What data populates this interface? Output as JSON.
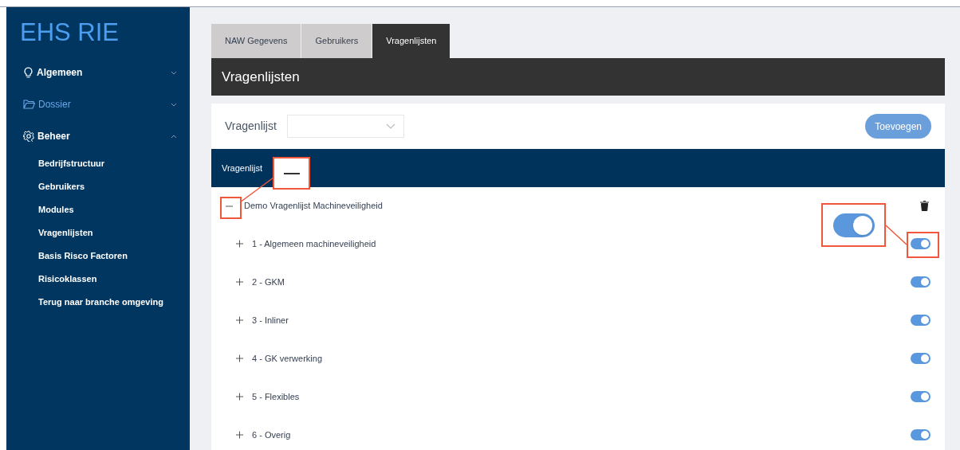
{
  "sidebar": {
    "logo": "EHS RIE",
    "items": [
      {
        "label": "Algemeen",
        "selected": false,
        "expanded": false
      },
      {
        "label": "Dossier",
        "selected": true,
        "expanded": false
      },
      {
        "label": "Beheer",
        "selected": false,
        "expanded": true,
        "children": [
          "Bedrijfstructuur",
          "Gebruikers",
          "Modules",
          "Vragenlijsten",
          "Basis Risco Factoren",
          "Risicoklassen",
          "Terug naar branche omgeving"
        ]
      }
    ]
  },
  "tabs": [
    {
      "label": "NAW Gegevens",
      "selected": false
    },
    {
      "label": "Gebruikers",
      "selected": false
    },
    {
      "label": "Vragenlijsten",
      "selected": true
    }
  ],
  "panel_title": "Vragenlijsten",
  "filter": {
    "label": "Vragenlijst"
  },
  "add_button": "Toevoegen",
  "table": {
    "column": "Vragenlijst",
    "rows": [
      {
        "label": "Demo Vragenlijst Machineveiligheid",
        "expanded": true,
        "children": [
          {
            "label": "1 - Algemeen machineveiligheid",
            "expanded": false,
            "on": true
          },
          {
            "label": "2 - GKM",
            "expanded": false,
            "on": true
          },
          {
            "label": "3 - Inliner",
            "expanded": false,
            "on": true
          },
          {
            "label": "4 - GK verwerking",
            "expanded": false,
            "on": true
          },
          {
            "label": "5 - Flexibles",
            "expanded": false,
            "on": true
          },
          {
            "label": "6 - Overig",
            "expanded": false,
            "on": true
          }
        ]
      }
    ]
  }
}
